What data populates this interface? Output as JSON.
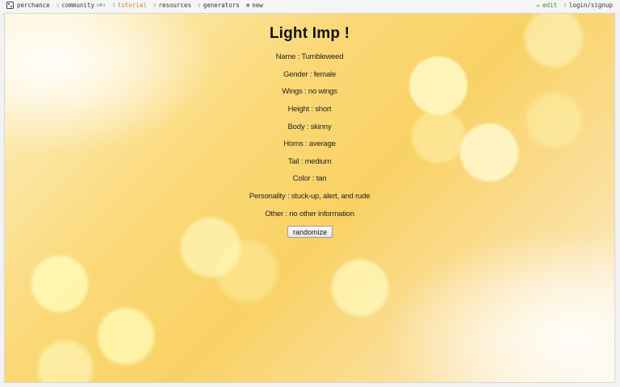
{
  "nav": {
    "logo_label": "perchance",
    "community_label": "community",
    "community_badge": "(dh)",
    "tutorial_label": "tutorial",
    "resources_label": "resources",
    "generators_label": "generators",
    "new_label": "new",
    "edit_label": "edit",
    "login_label": "login/signup"
  },
  "generator": {
    "title": "Light Imp !",
    "lines": [
      "Name : Tumbleweed",
      "Gender : female",
      "Wings : no wings",
      "Height : short",
      "Body : skinny",
      "Horns : average",
      "Tail : medium",
      "Color : tan",
      "Personality : stuck-up, alert, and rude",
      "Other : no other information"
    ],
    "button_label": "randomize"
  },
  "colors": {
    "tutorial_accent": "#d9822b",
    "edit_accent": "#2b8a2b"
  },
  "icons": {
    "logo": "dice-icon",
    "community": "chat-icon",
    "tutorial": "book-icon",
    "resources": "folder-icon",
    "generators": "list-icon",
    "new": "plus-circle-icon",
    "edit": "pencil-icon",
    "login": "user-icon"
  }
}
